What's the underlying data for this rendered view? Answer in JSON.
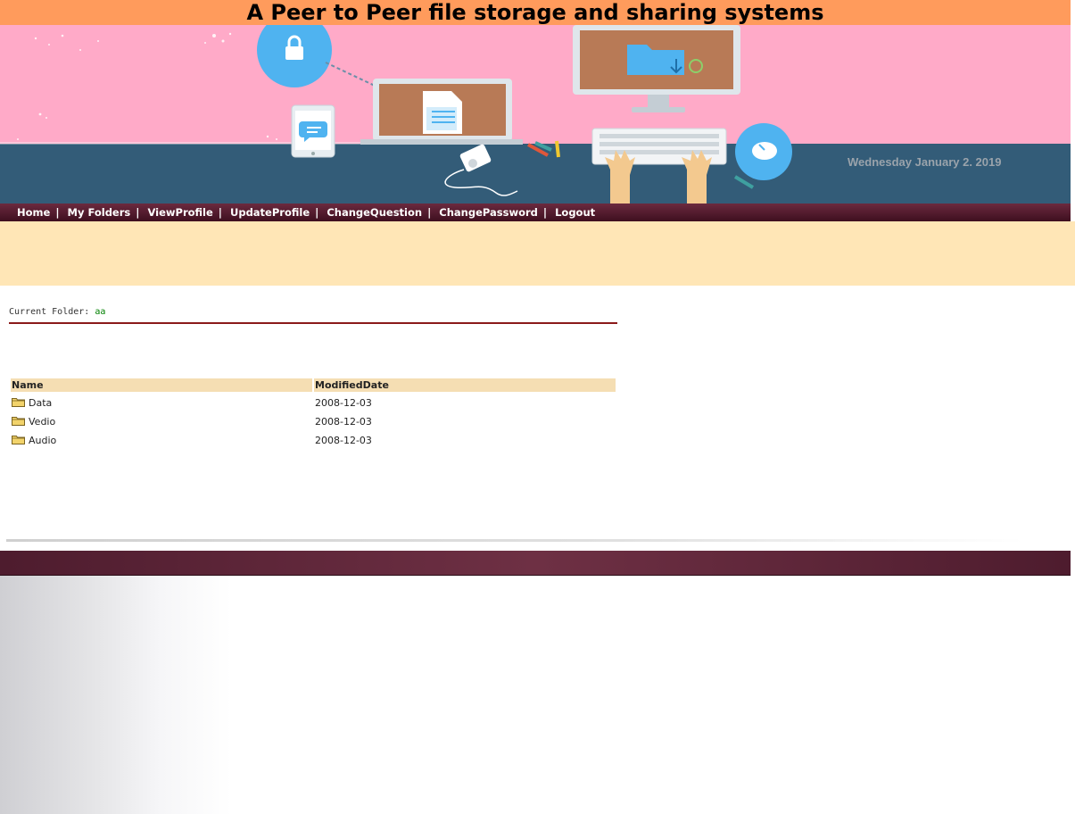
{
  "header": {
    "title": "A Peer to Peer file storage and sharing systems"
  },
  "banner": {
    "date": "Wednesday January 2. 2019"
  },
  "nav": {
    "items": [
      {
        "label": "Home"
      },
      {
        "label": "My Folders"
      },
      {
        "label": "ViewProfile"
      },
      {
        "label": "UpdateProfile"
      },
      {
        "label": "ChangeQuestion"
      },
      {
        "label": "ChangePassword"
      },
      {
        "label": "Logout"
      }
    ],
    "separator": "|"
  },
  "folder": {
    "label": "Current Folder:",
    "name": "aa"
  },
  "table": {
    "headers": {
      "name": "Name",
      "modified": "ModifiedDate"
    },
    "rows": [
      {
        "name": "Data",
        "modified": "2008-12-03"
      },
      {
        "name": "Vedio",
        "modified": "2008-12-03"
      },
      {
        "name": "Audio",
        "modified": "2008-12-03"
      }
    ]
  },
  "colors": {
    "title_bg": "#ff9b5c",
    "banner_pink": "#ffaac8",
    "banner_desk": "#335c78",
    "nav_bg": "#4a1226",
    "notice_bg": "#ffe6b6",
    "table_header_bg": "#f5deb3",
    "folder_name": "#008000",
    "rule": "#8b1a1a"
  }
}
